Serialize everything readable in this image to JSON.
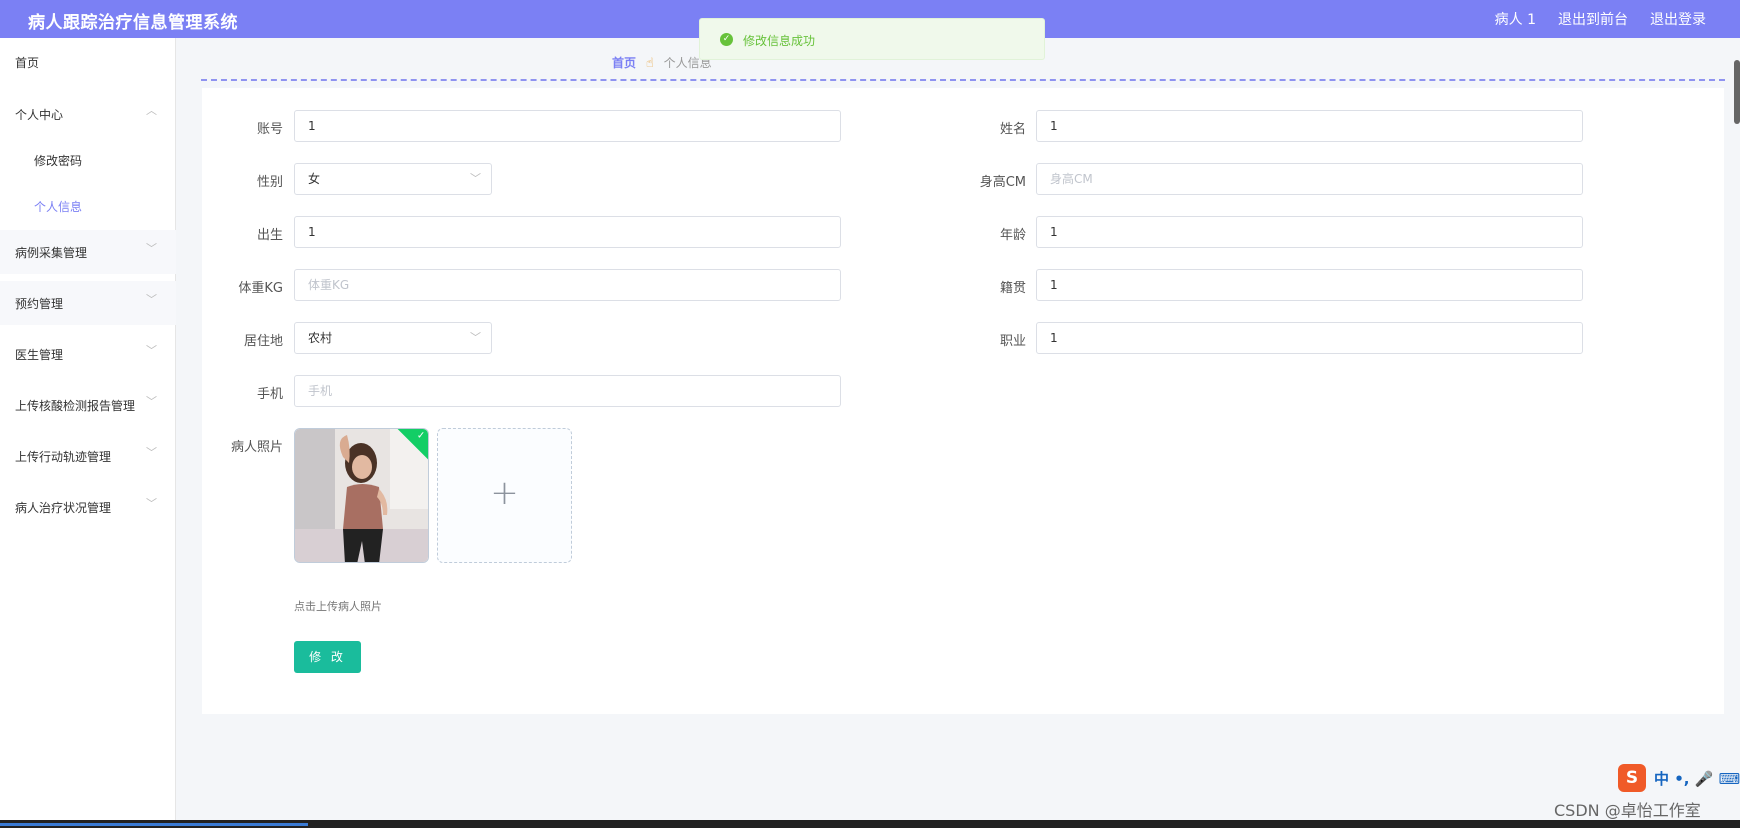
{
  "header": {
    "app_title": "病人跟踪治疗信息管理系统",
    "user_label": "病人 1",
    "front_label": "退出到前台",
    "logout_label": "退出登录"
  },
  "sidebar": {
    "items": [
      {
        "label": "首页"
      },
      {
        "label": "个人中心"
      },
      {
        "label": "修改密码"
      },
      {
        "label": "个人信息"
      },
      {
        "label": "病例采集管理"
      },
      {
        "label": "预约管理"
      },
      {
        "label": "医生管理"
      },
      {
        "label": "上传核酸检测报告管理"
      },
      {
        "label": "上传行动轨迹管理"
      },
      {
        "label": "病人治疗状况管理"
      }
    ]
  },
  "breadcrumb": {
    "home": "首页",
    "current": "个人信息"
  },
  "toast": {
    "message": "修改信息成功"
  },
  "form": {
    "account": {
      "label": "账号",
      "value": "1"
    },
    "name": {
      "label": "姓名",
      "value": "1"
    },
    "gender": {
      "label": "性别",
      "value": "女"
    },
    "height": {
      "label": "身高CM",
      "placeholder": "身高CM"
    },
    "birth": {
      "label": "出生",
      "value": "1"
    },
    "age": {
      "label": "年龄",
      "value": "1"
    },
    "weight": {
      "label": "体重KG",
      "placeholder": "体重KG"
    },
    "hometown": {
      "label": "籍贯",
      "value": "1"
    },
    "residence": {
      "label": "居住地",
      "value": "农村"
    },
    "job": {
      "label": "职业",
      "value": "1"
    },
    "phone": {
      "label": "手机",
      "placeholder": "手机"
    },
    "photo": {
      "label": "病人照片",
      "tip": "点击上传病人照片"
    },
    "submit_label": "修 改"
  },
  "ime": {
    "logo": "S",
    "text": "中 •, 🎤 ⌨"
  },
  "watermark": "CSDN @卓怡工作室"
}
